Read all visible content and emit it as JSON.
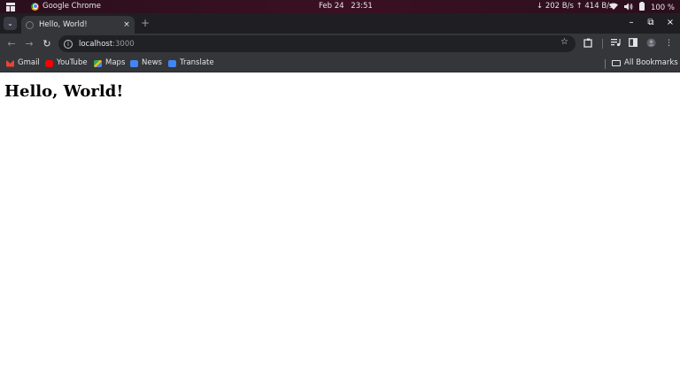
{
  "os_bar": {
    "app_name": "Google Chrome",
    "date": "Feb 24",
    "time": "23:51",
    "network": "↓ 202 B/s ↑ 414 B/s",
    "battery": "100 %",
    "icons": [
      "apps-grid-icon",
      "chrome-icon",
      "wifi-icon",
      "volume-icon",
      "battery-icon"
    ]
  },
  "browser": {
    "tab_title": "Hello, World!",
    "tab_close": "×",
    "new_tab": "+",
    "url_host": "localhost",
    "url_port": ":3000",
    "window_controls": [
      "–",
      "⧉",
      "×"
    ]
  },
  "bookmarks": [
    {
      "label": "Gmail",
      "icon": "gmail-icon",
      "color": "#ea4335"
    },
    {
      "label": "YouTube",
      "icon": "youtube-icon",
      "color": "#ff0000"
    },
    {
      "label": "Maps",
      "icon": "maps-icon",
      "color": "#34a853"
    },
    {
      "label": "News",
      "icon": "news-icon",
      "color": "#4285f4"
    },
    {
      "label": "Translate",
      "icon": "translate-icon",
      "color": "#4285f4"
    }
  ],
  "all_bookmarks": "All Bookmarks",
  "page": {
    "heading": "Hello, World!"
  }
}
